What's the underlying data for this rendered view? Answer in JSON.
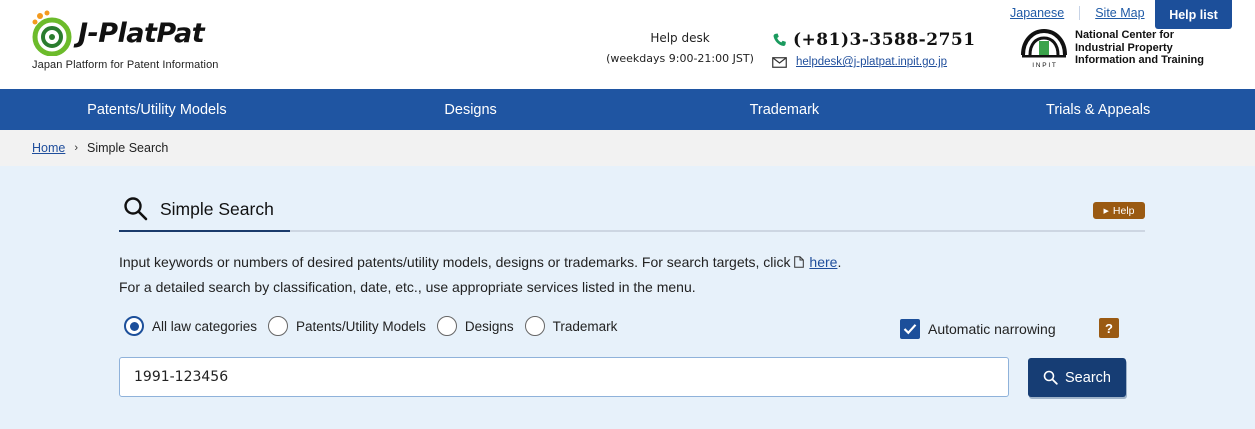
{
  "header": {
    "logo_text": "J-PlatPat",
    "logo_sub": "Japan Platform for Patent Information",
    "helpdesk_title": "Help desk",
    "helpdesk_hours": "(weekdays 9:00-21:00 JST)",
    "phone": "(+81)3-3588-2751",
    "email": "helpdesk@j-platpat.inpit.go.jp",
    "inpit_line1": "National Center for",
    "inpit_line2": "Industrial Property",
    "inpit_line3": "Information and Training",
    "inpit_abbr": "I N P I T",
    "links": {
      "japanese": "Japanese",
      "sitemap": "Site Map"
    },
    "help_list": "Help list"
  },
  "nav": {
    "items": [
      {
        "label": "Patents/Utility Models"
      },
      {
        "label": "Designs"
      },
      {
        "label": "Trademark"
      },
      {
        "label": "Trials & Appeals"
      }
    ]
  },
  "breadcrumb": {
    "home": "Home",
    "sep": "›",
    "current": "Simple Search"
  },
  "main": {
    "title": "Simple Search",
    "help_badge": "Help",
    "desc_line1_pre": "Input keywords or numbers of desired patents/utility models, designs or trademarks. For search targets, click ",
    "desc_line1_link": "here",
    "desc_line1_post": ".",
    "desc_line2": "For a detailed search by classification, date, etc., use appropriate services listed in the menu.",
    "radios": [
      {
        "label": "All law categories",
        "checked": true
      },
      {
        "label": "Patents/Utility Models",
        "checked": false
      },
      {
        "label": "Designs",
        "checked": false
      },
      {
        "label": "Trademark",
        "checked": false
      }
    ],
    "auto_narrowing": "Automatic narrowing",
    "question_badge": "?",
    "search_value": "1991-123456",
    "search_button": "Search"
  },
  "colors": {
    "nav": "#1f55a2",
    "accent": "#1c4f9a",
    "help_badge": "#9a5a12",
    "main_bg": "#e7f1fa"
  },
  "icons": [
    "logo-mark",
    "phone-icon",
    "mail-icon",
    "inpit-logo",
    "search-icon",
    "doc-icon",
    "checkmark-icon"
  ]
}
